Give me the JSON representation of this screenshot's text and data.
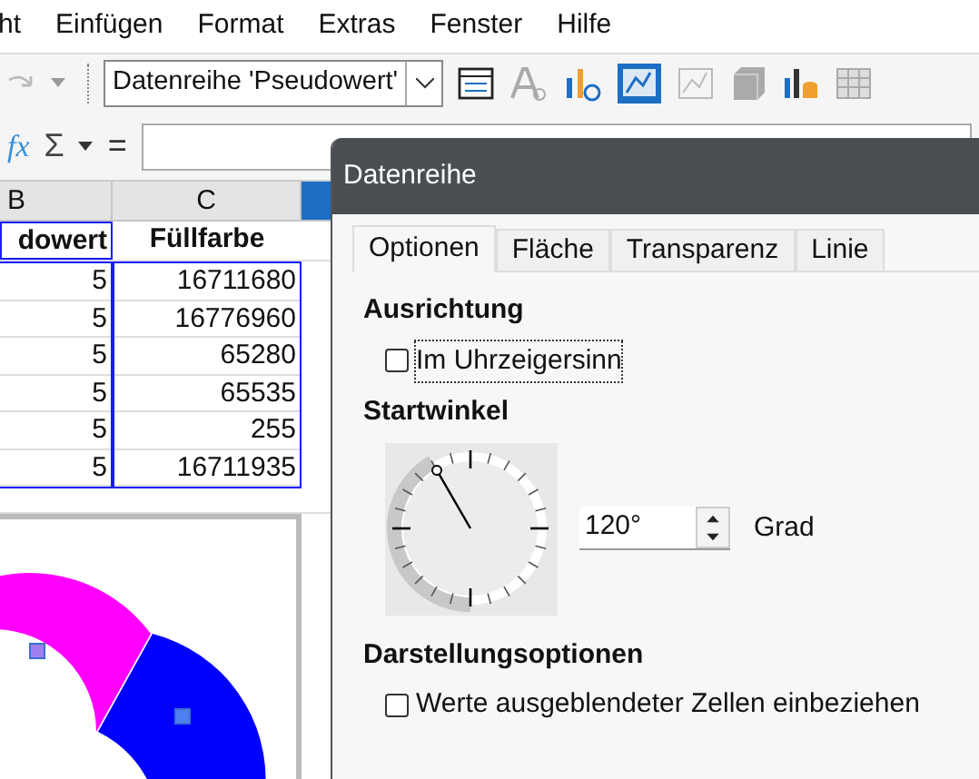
{
  "menu": [
    "ht",
    "Einfügen",
    "Format",
    "Extras",
    "Fenster",
    "Hilfe"
  ],
  "toolbar": {
    "series_select": "Datenreihe 'Pseudowert'"
  },
  "formula_bar": {
    "fx": "fx",
    "sum": "Σ",
    "equals": "="
  },
  "sheet": {
    "columns": [
      "B",
      "C"
    ],
    "header": [
      "dowert",
      "Füllfarbe"
    ],
    "rows": [
      [
        "5",
        "16711680"
      ],
      [
        "5",
        "16776960"
      ],
      [
        "5",
        "65280"
      ],
      [
        "5",
        "65535"
      ],
      [
        "5",
        "255"
      ],
      [
        "5",
        "16711935"
      ]
    ]
  },
  "dialog": {
    "title": "Datenreihe",
    "tabs": [
      {
        "label": "Optionen",
        "selected": true
      },
      {
        "label": "Fläche",
        "selected": false
      },
      {
        "label": "Transparenz",
        "selected": false
      },
      {
        "label": "Linie",
        "selected": false
      }
    ],
    "orientation_heading": "Ausrichtung",
    "clockwise": {
      "label": "Im Uhrzeigersinn",
      "checked": false
    },
    "angle_heading": "Startwinkel",
    "angle_value": "120°",
    "angle_unit": "Grad",
    "display_heading": "Darstellungsoptionen",
    "hidden_cells": {
      "label": "Werte ausgeblendeter Zellen einbeziehen",
      "checked": false
    }
  }
}
